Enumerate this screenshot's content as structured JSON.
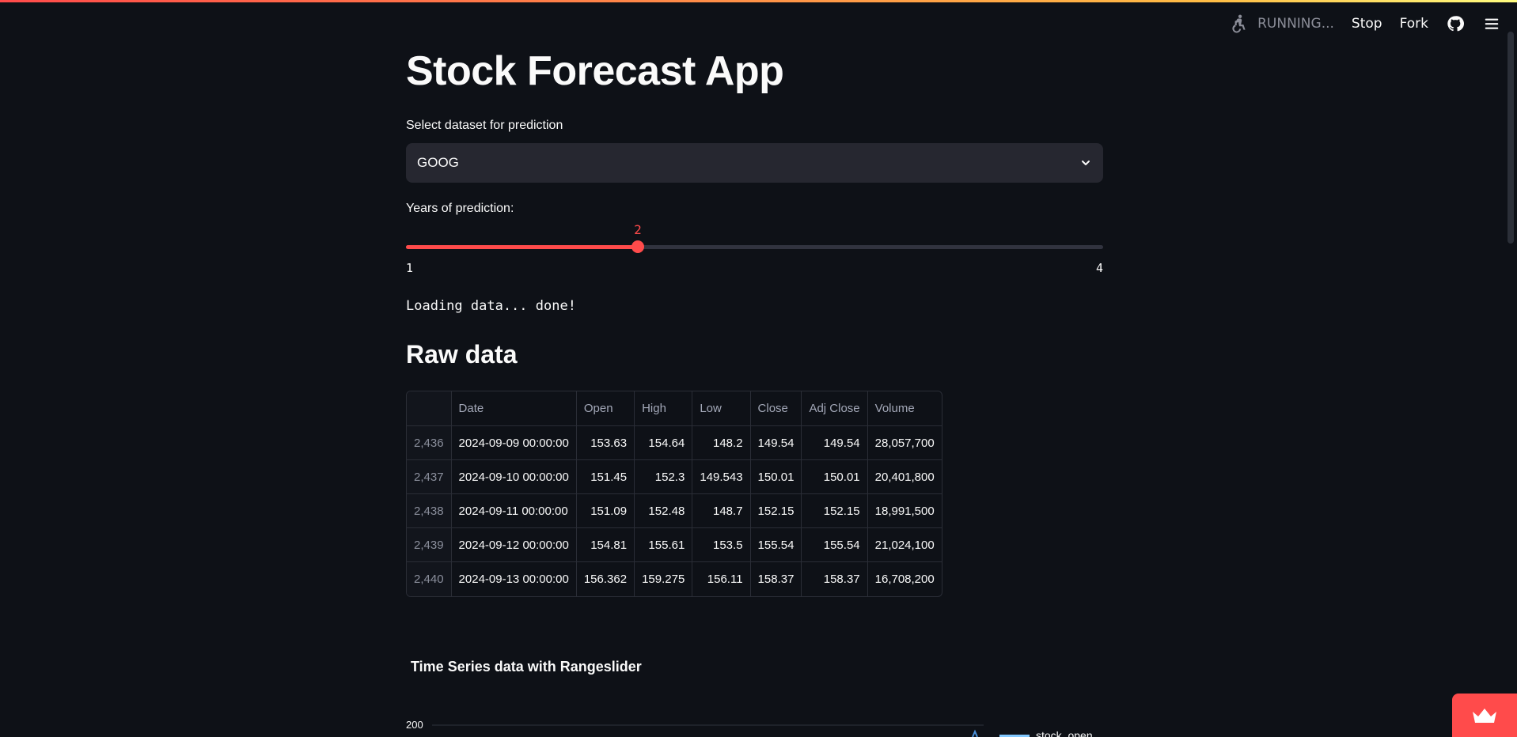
{
  "header": {
    "status": "RUNNING...",
    "stop_label": "Stop",
    "fork_label": "Fork",
    "icons": [
      "running-man-icon",
      "github-icon",
      "hamburger-menu-icon"
    ]
  },
  "main": {
    "title": "Stock Forecast App",
    "select_label": "Select dataset for prediction",
    "select_value": "GOOG",
    "slider_label": "Years of prediction:",
    "slider": {
      "value": "2",
      "min": "1",
      "max": "4",
      "fraction": 0.333
    },
    "loading_text": "Loading data... done!",
    "raw_data_heading": "Raw data",
    "table": {
      "columns": [
        "",
        "Date",
        "Open",
        "High",
        "Low",
        "Close",
        "Adj Close",
        "Volume"
      ],
      "rows": [
        [
          "2,436",
          "2024-09-09 00:00:00",
          "153.63",
          "154.64",
          "148.2",
          "149.54",
          "149.54",
          "28,057,700"
        ],
        [
          "2,437",
          "2024-09-10 00:00:00",
          "151.45",
          "152.3",
          "149.543",
          "150.01",
          "150.01",
          "20,401,800"
        ],
        [
          "2,438",
          "2024-09-11 00:00:00",
          "151.09",
          "152.48",
          "148.7",
          "152.15",
          "152.15",
          "18,991,500"
        ],
        [
          "2,439",
          "2024-09-12 00:00:00",
          "154.81",
          "155.61",
          "153.5",
          "155.54",
          "155.54",
          "21,024,100"
        ],
        [
          "2,440",
          "2024-09-13 00:00:00",
          "156.362",
          "159.275",
          "156.11",
          "158.37",
          "158.37",
          "16,708,200"
        ]
      ]
    },
    "chart_title": "Time Series data with Rangeslider",
    "chart_tick": "200",
    "legend_label": "stock_open"
  },
  "colors": {
    "accent": "#ff4b4b",
    "background": "#0e1117",
    "widget": "#262730"
  }
}
